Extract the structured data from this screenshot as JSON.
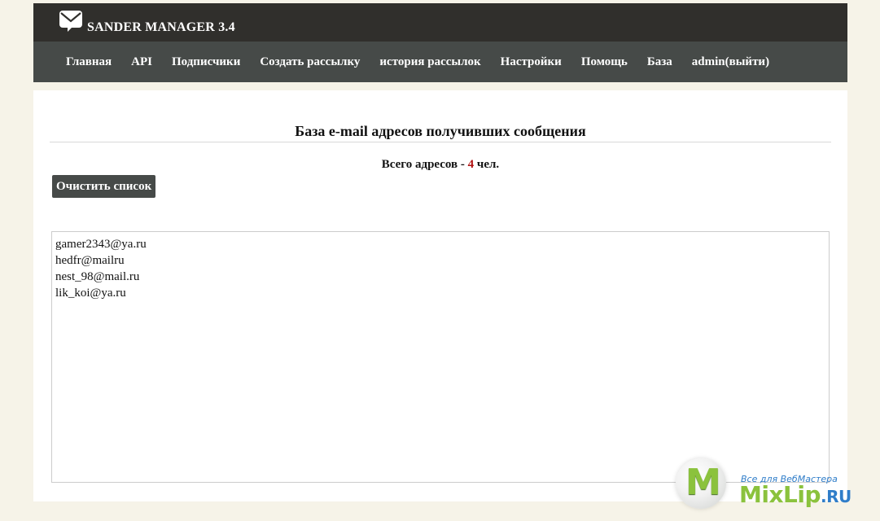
{
  "header": {
    "brand": "SANDER MANAGER 3.4",
    "logo_icon": "mail-icon"
  },
  "nav": {
    "items": [
      {
        "label": "Главная"
      },
      {
        "label": "API"
      },
      {
        "label": "Подписчики"
      },
      {
        "label": "Создать рассылку"
      },
      {
        "label": "история рассылок"
      },
      {
        "label": "Настройки"
      },
      {
        "label": "Помощь"
      },
      {
        "label": "База"
      },
      {
        "label": "admin(выйти)"
      }
    ]
  },
  "main": {
    "title": "База e-mail адресов получивших сообщения",
    "total_prefix": "Всего адресов - ",
    "total_count": "4",
    "total_suffix": " чел.",
    "clear_button": "Очистить список",
    "emails": [
      "gamer2343@ya.ru",
      "hedfr@mailru",
      "nest_98@mail.ru",
      "lik_koi@ya.ru"
    ]
  },
  "watermark": {
    "letter": "M",
    "tagline": "Все для ВебМастера",
    "name": "MixLip",
    "tld": ".RU"
  },
  "colors": {
    "topbar": "#302f2c",
    "nav": "#464a48",
    "background": "#f6f3e8",
    "count": "#b01212"
  }
}
